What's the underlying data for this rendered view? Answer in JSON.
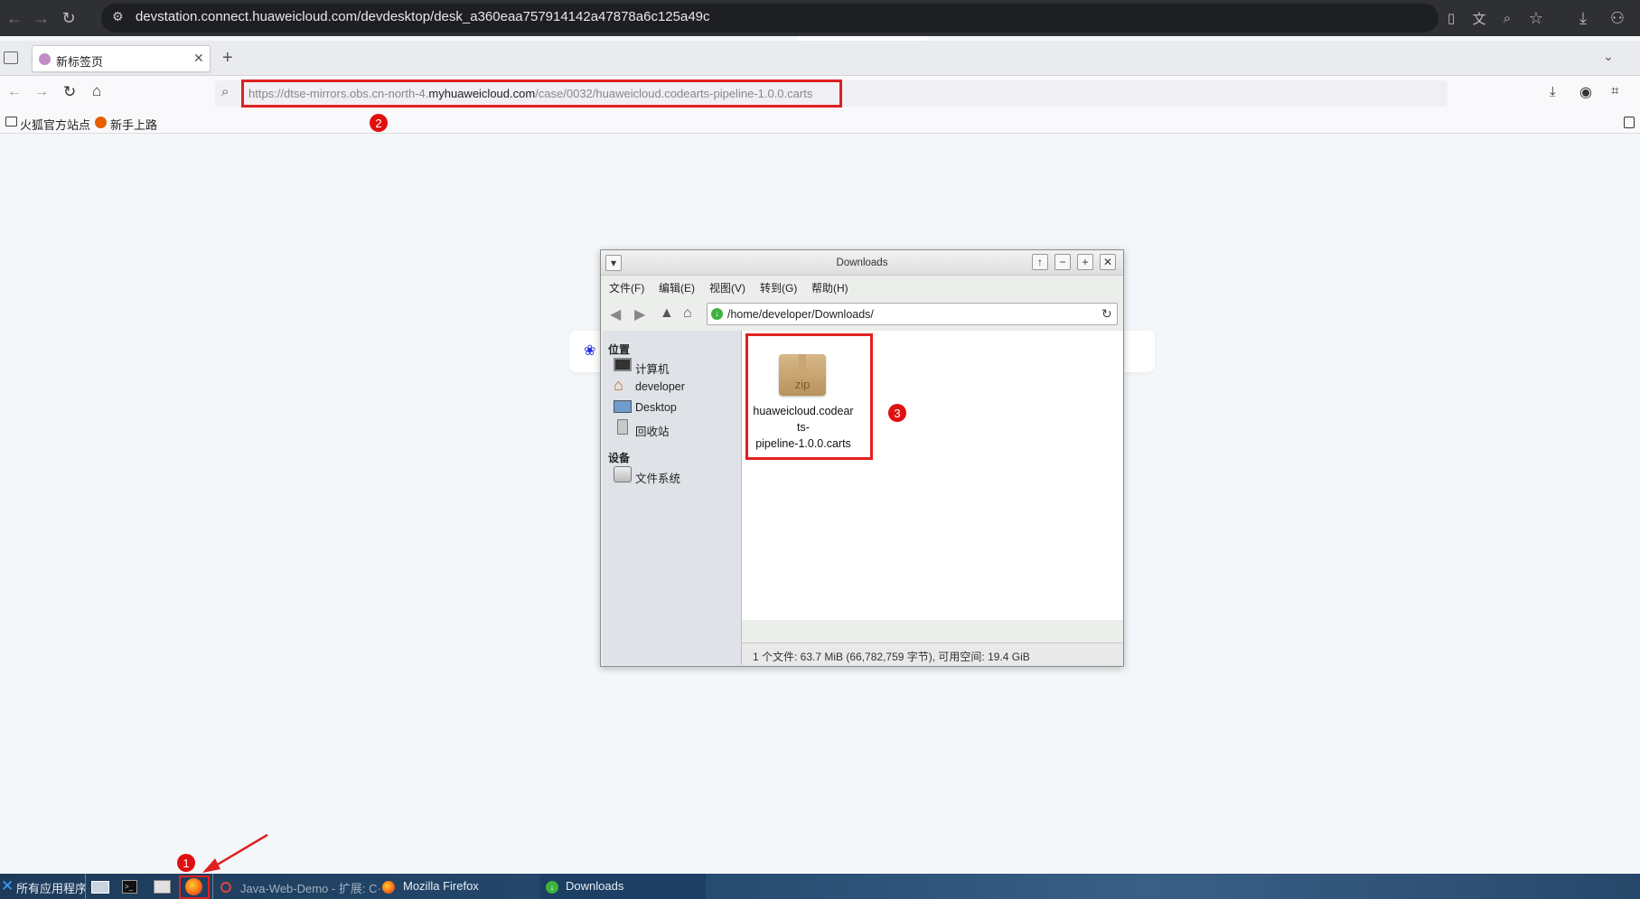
{
  "chrome": {
    "url": "devstation.connect.huaweicloud.com/devdesktop/desk_a360eaa757914142a47878a6c125a49c"
  },
  "firefox": {
    "tab_title": "新标签页",
    "url_prefix": "https://dtse-mirrors.obs.cn-north-4.",
    "url_domain": "myhuaweicloud.com",
    "url_suffix": "/case/0032/huaweicloud.codearts-pipeline-1.0.0.carts",
    "bookmarks": [
      "火狐官方站点",
      "新手上路"
    ]
  },
  "file_manager": {
    "title": "Downloads",
    "menu": [
      "文件(F)",
      "编辑(E)",
      "视图(V)",
      "转到(G)",
      "帮助(H)"
    ],
    "path": "/home/developer/Downloads/",
    "places_header": "位置",
    "places": [
      "计算机",
      "developer",
      "Desktop",
      "回收站"
    ],
    "devices_header": "设备",
    "devices": [
      "文件系统"
    ],
    "file": {
      "icon_label": "zip",
      "name_line1": "huaweicloud.codear",
      "name_line2": "ts-",
      "name_line3": "pipeline-1.0.0.carts"
    },
    "status": "1 个文件: 63.7 MiB (66,782,759 字节), 可用空间: 19.4 GiB"
  },
  "annotations": {
    "badge1": "1",
    "badge2": "2",
    "badge3": "3"
  },
  "taskbar": {
    "apps_label": "所有应用程序",
    "tasks": [
      "Java-Web-Demo - 扩展: C···",
      "Mozilla Firefox",
      "Downloads"
    ]
  },
  "colors": {
    "annotation_red": "#e02020",
    "taskbar": "#24496d"
  }
}
